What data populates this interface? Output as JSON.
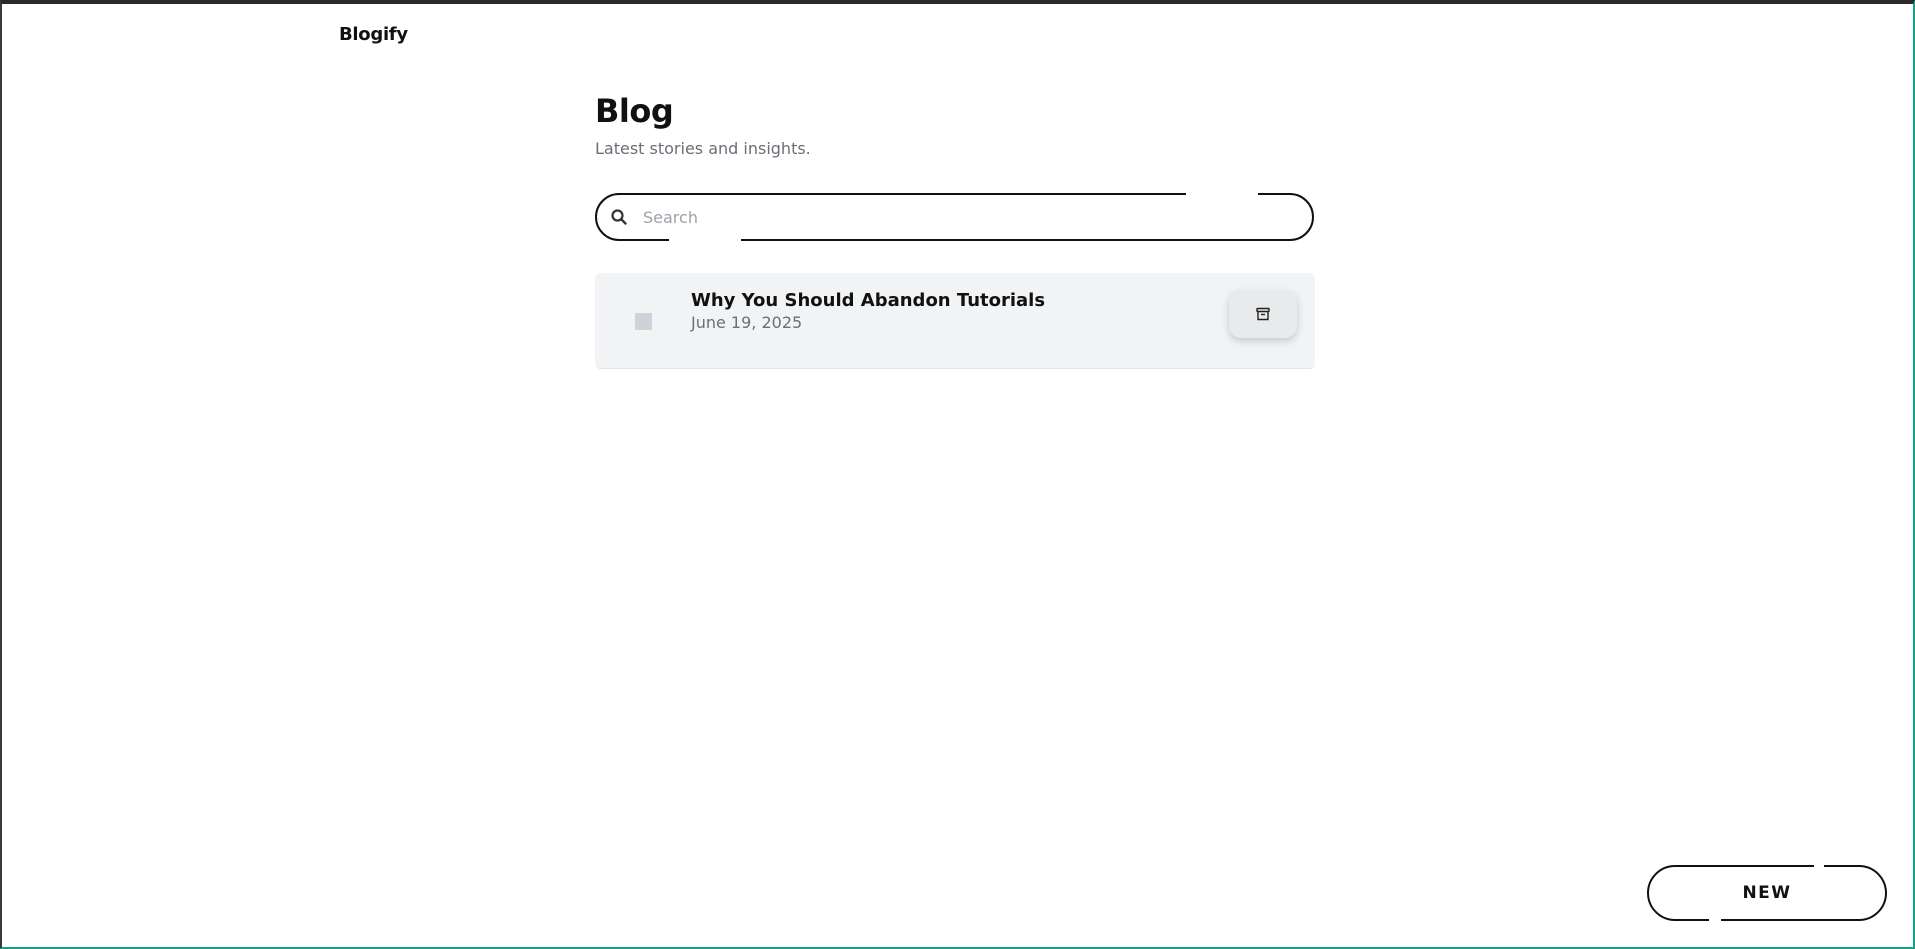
{
  "header": {
    "brand": "Blogify"
  },
  "page": {
    "title": "Blog",
    "subtitle": "Latest stories and insights."
  },
  "search": {
    "placeholder": "Search",
    "value": "",
    "icon": "search-icon"
  },
  "posts": [
    {
      "title": "Why You Should Abandon Tutorials",
      "date": "June 19, 2025",
      "action_icon": "archive-icon"
    }
  ],
  "actions": {
    "new_label": "NEW"
  },
  "colors": {
    "text": "#111111",
    "muted": "#6b6f76",
    "card_bg": "#f2f3f5",
    "frame_accent": "#16a085"
  }
}
